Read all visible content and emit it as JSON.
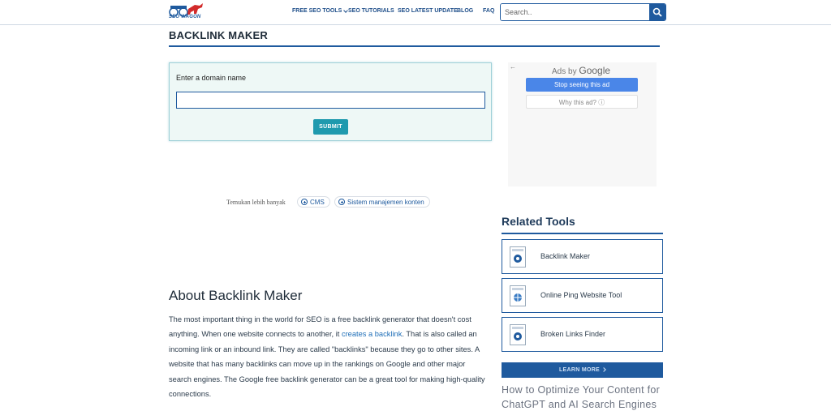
{
  "header": {
    "logo_text": "SEO WAGON",
    "nav": [
      {
        "label": "FREE SEO TOOLS"
      },
      {
        "label": "SEO TUTORIALS"
      },
      {
        "label": "SEO LATEST UPDATE"
      },
      {
        "label": "BLOG"
      },
      {
        "label": "FAQ"
      }
    ],
    "search_placeholder": "Search.."
  },
  "page": {
    "title": "BACKLINK MAKER"
  },
  "form": {
    "label": "Enter a domain name",
    "domain_value": "",
    "submit_label": "SUBMIT"
  },
  "ad": {
    "back_arrow": "←",
    "ads_by": "Ads by",
    "google": "Google",
    "stop_label": "Stop seeing this ad",
    "why_label": "Why this ad? ⓘ"
  },
  "discover": {
    "label": "Temukan lebih banyak",
    "chips": [
      "CMS",
      "Sistem manajemen konten"
    ]
  },
  "related": {
    "title": "Related Tools",
    "tools": [
      {
        "label": "Backlink Maker"
      },
      {
        "label": "Online Ping Website Tool"
      },
      {
        "label": "Broken Links Finder"
      }
    ],
    "learn_more": "LEARN MORE",
    "promo": "How to Optimize Your Content for ChatGPT and AI Search Engines"
  },
  "about": {
    "title": "About Backlink Maker",
    "text_before": "The most important thing in the world for SEO is a free backlink generator that doesn't cost anything. When one website connects to another, it ",
    "link": "creates a backlink",
    "text_after": ". That is also called an incoming link or an inbound link. They are called \"backlinks\" because they go to other sites. A website that has many backlinks can move up in the rankings on Google and other major search engines. The Google free backlink generator can be a great tool for making high-quality connections."
  },
  "colors": {
    "brand": "#1f5a9e",
    "submit": "#1f9aae",
    "ad_button": "#4a86e8"
  }
}
